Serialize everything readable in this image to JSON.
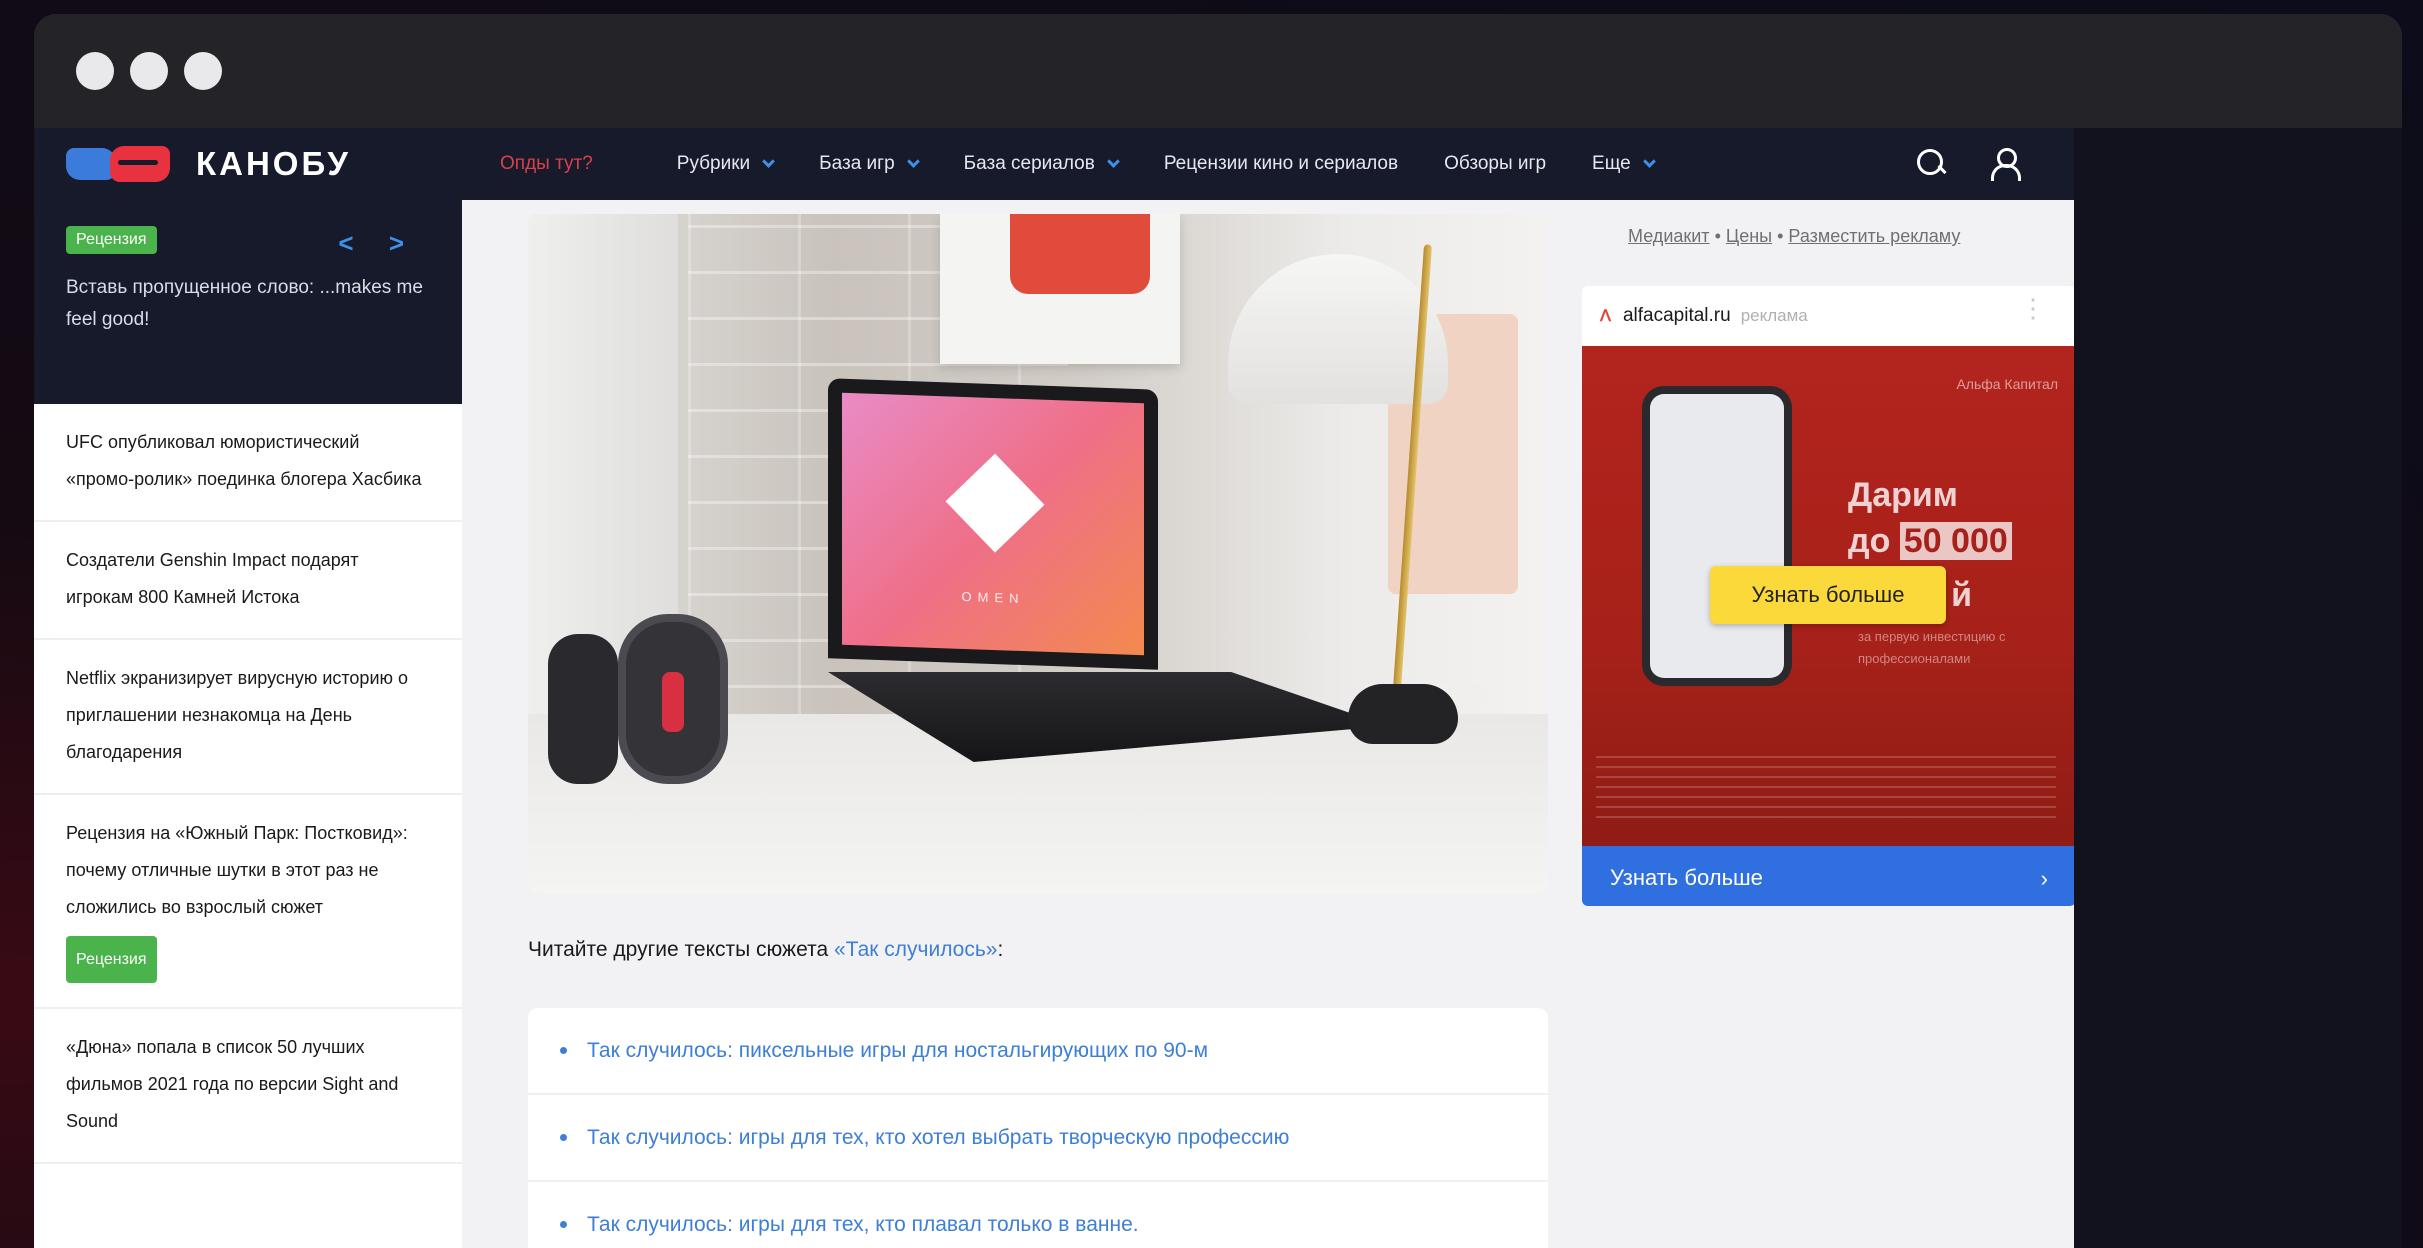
{
  "nav": {
    "logo": "КАНОБУ",
    "items": [
      {
        "label": "Опды тут?",
        "dropdown": false,
        "highlight": true
      },
      {
        "label": "Рубрики",
        "dropdown": true
      },
      {
        "label": "База игр",
        "dropdown": true
      },
      {
        "label": "База сериалов",
        "dropdown": true
      },
      {
        "label": "Рецензии кино и сериалов",
        "dropdown": false
      },
      {
        "label": "Обзоры игр",
        "dropdown": false
      },
      {
        "label": "Еще",
        "dropdown": true
      }
    ]
  },
  "sidebar": {
    "featured": {
      "badge": "Рецензия",
      "arrows": "< >",
      "text": "Вставь пропущенное слово: ...makes me feel good!"
    },
    "items": [
      {
        "text": "UFC опубликовал юмористический «промо-ролик» поединка блогера Хасбика"
      },
      {
        "text": "Создатели Genshin Impact подарят игрокам 800 Камней Истока"
      },
      {
        "text": "Netflix экранизирует вирусную историю о приглашении незнакомца на День благодарения"
      },
      {
        "text": "Рецензия на «Южный Парк: Постковид»: почему отличные шутки в этот раз не сложились во взрослый сюжет",
        "badge": "Рецензия"
      },
      {
        "text": "«Дюна» попала в список 50 лучших фильмов 2021 года по версии Sight and Sound"
      }
    ]
  },
  "main": {
    "hero": {
      "screen_brand": "OMEN"
    },
    "read_more_prefix": "Читайте другие тексты сюжета ",
    "read_more_link": "«Так случилось»",
    "read_more_suffix": ":",
    "links": [
      "Так случилось: пиксельные игры для ностальгирующих по 90-м",
      "Так случилось: игры для тех, кто хотел выбрать творческую профессию",
      "Так случилось: игры для тех, кто плавал только в ванне."
    ]
  },
  "ad": {
    "links": {
      "mediakit": "Медиакит",
      "sep": " • ",
      "prices": "Цены",
      "place": "Разместить рекламу"
    },
    "advertiser": "alfacapital.ru",
    "tag": "реклама",
    "brand": "Альфа Капитал",
    "promo_line1": "Дарим",
    "promo_line2_prefix": "до ",
    "promo_line2_amount": "50 000",
    "promo_suffix": "й",
    "sub": "за первую инвестицию с профессионалами",
    "yellow_cta": "Узнать больше",
    "cta": "Узнать больше",
    "cta_arrow": "›"
  },
  "colors": {
    "accent": "#3d7fd6",
    "nav_bg": "#161a2b",
    "badge": "#4bb34b",
    "ad_cta": "#2f6fe0"
  }
}
